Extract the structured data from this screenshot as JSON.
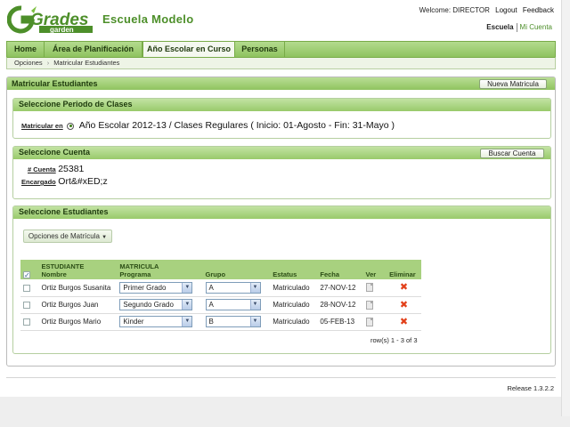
{
  "header": {
    "logo_text_top": "Grades",
    "logo_text_bottom": "garden",
    "school_name": "Escuela Modelo",
    "welcome": "Welcome: DIRECTOR",
    "logout": "Logout",
    "feedback": "Feedback",
    "role_current": "Escuela",
    "role_other": "Mi Cuenta"
  },
  "nav": {
    "tabs": [
      {
        "label": "Home"
      },
      {
        "label": "Área de Planificación"
      },
      {
        "label": "Año Escolar en Curso"
      },
      {
        "label": "Personas"
      }
    ],
    "active_index": 2
  },
  "breadcrumb": [
    "Opciones",
    "Matricular Estudiantes"
  ],
  "main_panel": {
    "title": "Matricular Estudiantes",
    "new_button": "Nueva Matricula"
  },
  "period": {
    "title": "Seleccione Periodo de Clases",
    "label": "Matricular en",
    "value": "Año Escolar 2012-13 / Clases Regulares ( Inicio: 01-Agosto - Fin: 31-Mayo )"
  },
  "account": {
    "title": "Seleccione Cuenta",
    "search_button": "Buscar Cuenta",
    "number_label": "# Cuenta",
    "number_value": "25381",
    "guardian_label": "Encargado",
    "guardian_value": "Ort&#xED;z"
  },
  "students": {
    "title": "Seleccione Estudiantes",
    "options_button": "Opciones de Matrícula",
    "columns": {
      "student_top": "ESTUDIANTE",
      "student_bottom": "Nombre",
      "program_top": "MATRICULA",
      "program_bottom": "Programa",
      "group": "Grupo",
      "status": "Estatus",
      "date": "Fecha",
      "view": "Ver",
      "delete": "Eliminar"
    },
    "rows": [
      {
        "name": "Ortiz Burgos Susanita",
        "program": "Primer Grado",
        "group": "A",
        "status": "Matriculado",
        "date": "27-NOV-12"
      },
      {
        "name": "Ortiz Burgos Juan",
        "program": "Segundo Grado",
        "group": "A",
        "status": "Matriculado",
        "date": "28-NOV-12"
      },
      {
        "name": "Ortiz Burgos Mario",
        "program": "Kinder",
        "group": "B",
        "status": "Matriculado",
        "date": "05-FEB-13"
      }
    ],
    "row_count": "row(s) 1 - 3 of 3"
  },
  "footer": {
    "release": "Release 1.3.2.2"
  },
  "colors": {
    "brand_green": "#4d8f2a",
    "header_green": "#8fc35f",
    "delete_red": "#e2401a"
  }
}
